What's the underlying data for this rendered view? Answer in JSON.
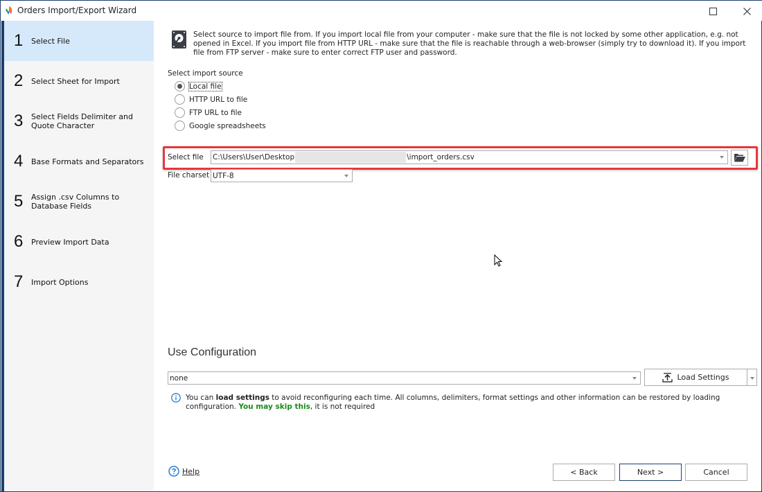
{
  "window": {
    "title": "Orders Import/Export Wizard",
    "icon": "app-logo-icon",
    "maximize_icon": "maximize-icon",
    "close_icon": "close-icon"
  },
  "steps": [
    {
      "number": "1",
      "label": "Select File",
      "active": true
    },
    {
      "number": "2",
      "label": "Select Sheet for Import",
      "active": false
    },
    {
      "number": "3",
      "label": "Select Fields Delimiter and Quote Character",
      "active": false
    },
    {
      "number": "4",
      "label": "Base Formats and Separators",
      "active": false
    },
    {
      "number": "5",
      "label": "Assign .csv Columns to Database Fields",
      "active": false
    },
    {
      "number": "6",
      "label": "Preview Import Data",
      "active": false
    },
    {
      "number": "7",
      "label": "Import Options",
      "active": false
    }
  ],
  "description": "Select source to import file from. If you import local file from your computer - make sure that the file is not locked by some other application, e.g. not opened in Excel. If you import file from HTTP URL - make sure that the file is reachable through a web-browser (simply try to download it). If you import file from FTP server - make sure to enter correct FTP user and password.",
  "import_source": {
    "label": "Select import source",
    "options": [
      {
        "label": "Local file",
        "selected": true
      },
      {
        "label": "HTTP URL to file",
        "selected": false
      },
      {
        "label": "FTP URL to file",
        "selected": false
      },
      {
        "label": "Google spreadsheets",
        "selected": false
      }
    ]
  },
  "select_file": {
    "label": "Select file",
    "value_prefix": "C:\\Users\\User\\Desktop",
    "value_suffix": "\\import_orders.csv",
    "browse_icon": "folder-open-icon"
  },
  "file_charset": {
    "label": "File charset",
    "value": "UTF-8"
  },
  "configuration": {
    "title": "Use Configuration",
    "value": "none",
    "load_button": "Load Settings",
    "info_part1": "You can ",
    "info_bold": "load settings",
    "info_part2": " to avoid reconfiguring each time. All columns, delimiters, format settings and other information can be restored by loading configuration. ",
    "info_green": "You may skip this",
    "info_part3": ", it is not required"
  },
  "footer": {
    "help": "Help",
    "back": "< Back",
    "next": "Next >",
    "cancel": "Cancel"
  }
}
